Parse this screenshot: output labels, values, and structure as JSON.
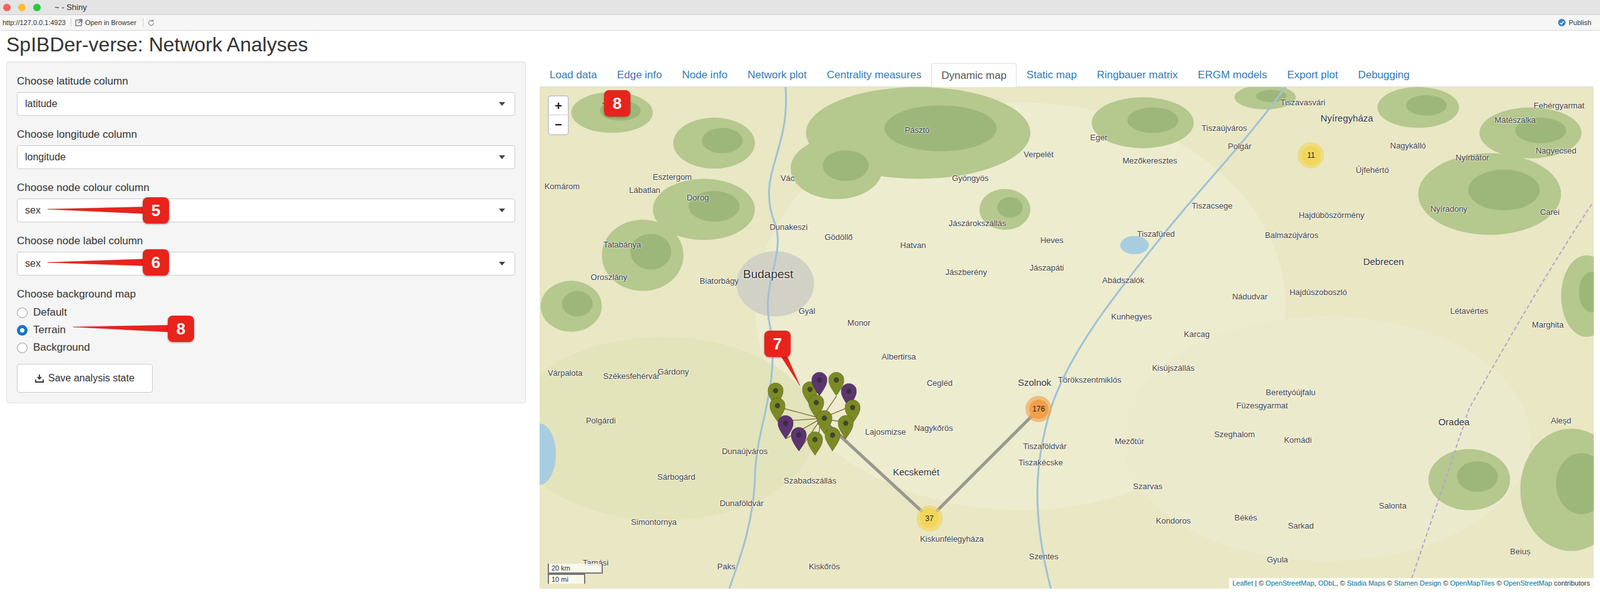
{
  "window": {
    "title": "~ - Shiny"
  },
  "toolbar": {
    "url": "http://127.0.0.1:4923",
    "open_in_browser": "Open in Browser",
    "publish": "Publish"
  },
  "app_title": "SpIBDer-verse: Network Analyses",
  "sidebar": {
    "fields": [
      {
        "label": "Choose latitude column",
        "value": "latitude"
      },
      {
        "label": "Choose longitude column",
        "value": "longitude"
      },
      {
        "label": "Choose node colour column",
        "value": "sex"
      },
      {
        "label": "Choose node label column",
        "value": "sex"
      }
    ],
    "background_map": {
      "label": "Choose background map",
      "options": [
        {
          "label": "Default",
          "selected": false
        },
        {
          "label": "Terrain",
          "selected": true
        },
        {
          "label": "Background",
          "selected": false
        }
      ]
    },
    "save_button": "Save analysis state"
  },
  "tabs": [
    {
      "label": "Load data",
      "selected": false
    },
    {
      "label": "Edge info",
      "selected": false
    },
    {
      "label": "Node info",
      "selected": false
    },
    {
      "label": "Network plot",
      "selected": false
    },
    {
      "label": "Centrality measures",
      "selected": false
    },
    {
      "label": "Dynamic map",
      "selected": true
    },
    {
      "label": "Static map",
      "selected": false
    },
    {
      "label": "Ringbauer matrix",
      "selected": false
    },
    {
      "label": "ERGM models",
      "selected": false
    },
    {
      "label": "Export plot",
      "selected": false
    },
    {
      "label": "Debugging",
      "selected": false
    }
  ],
  "map": {
    "zoom_in": "+",
    "zoom_out": "−",
    "scale": [
      "20 km",
      "10 mi"
    ],
    "attribution": [
      {
        "text": "Leaflet",
        "link": true
      },
      {
        "text": " | © ",
        "link": false
      },
      {
        "text": "OpenStreetMap",
        "link": true
      },
      {
        "text": ", ",
        "link": false
      },
      {
        "text": "ODbL",
        "link": true
      },
      {
        "text": ", © ",
        "link": false
      },
      {
        "text": "Stadia Maps",
        "link": true
      },
      {
        "text": " © ",
        "link": false
      },
      {
        "text": "Stamen Design",
        "link": true
      },
      {
        "text": " © ",
        "link": false
      },
      {
        "text": "OpenMapTiles",
        "link": true
      },
      {
        "text": " © ",
        "link": false
      },
      {
        "text": "OpenStreetMap",
        "link": true
      },
      {
        "text": " contributors",
        "link": false
      }
    ],
    "clusters": [
      {
        "count": "11",
        "color": "#f1d65a"
      },
      {
        "count": "176",
        "color": "#f2a04a"
      },
      {
        "count": "37",
        "color": "#f1d65a"
      }
    ],
    "pins": [
      {
        "color": "#7b8a24"
      },
      {
        "color": "#7b8a24"
      },
      {
        "color": "#7b8a24"
      },
      {
        "color": "#5c3470"
      },
      {
        "color": "#7b8a24"
      },
      {
        "color": "#5c3470"
      },
      {
        "color": "#7b8a24"
      },
      {
        "color": "#7b8a24"
      },
      {
        "color": "#7b8a24"
      },
      {
        "color": "#7b8a24"
      },
      {
        "color": "#7b8a24"
      },
      {
        "color": "#5c3470"
      },
      {
        "color": "#5c3470"
      },
      {
        "color": "#7b8a24"
      }
    ],
    "labels": [
      {
        "text": "Pásztó",
        "kind": "town"
      },
      {
        "text": "Eger",
        "kind": "town"
      },
      {
        "text": "Tiszavasvári",
        "kind": "town"
      },
      {
        "text": "Nyíregyháza",
        "kind": "city"
      },
      {
        "text": "Mátészalka",
        "kind": "town"
      },
      {
        "text": "Fehérgyarmat",
        "kind": "town"
      },
      {
        "text": "Tiszaújváros",
        "kind": "town"
      },
      {
        "text": "Polgár",
        "kind": "town"
      },
      {
        "text": "Nagykálló",
        "kind": "town"
      },
      {
        "text": "Nagyecsed",
        "kind": "town"
      },
      {
        "text": "Újfehértó",
        "kind": "town"
      },
      {
        "text": "Nyírbátor",
        "kind": "town"
      },
      {
        "text": "Verpelét",
        "kind": "town"
      },
      {
        "text": "Mezőkeresztes",
        "kind": "town"
      },
      {
        "text": "Gyöngyös",
        "kind": "town"
      },
      {
        "text": "Vác",
        "kind": "town"
      },
      {
        "text": "Esztergom",
        "kind": "town"
      },
      {
        "text": "Dorog",
        "kind": "town"
      },
      {
        "text": "Komárom",
        "kind": "town"
      },
      {
        "text": "Lábatlan",
        "kind": "town"
      },
      {
        "text": "Tiszacsege",
        "kind": "town"
      },
      {
        "text": "Hajdúböszörmény",
        "kind": "town"
      },
      {
        "text": "Nyíradony",
        "kind": "town"
      },
      {
        "text": "Carei",
        "kind": "town"
      },
      {
        "text": "Tatabánya",
        "kind": "town"
      },
      {
        "text": "Dunakeszi",
        "kind": "town"
      },
      {
        "text": "Gödöllő",
        "kind": "town"
      },
      {
        "text": "Hatvan",
        "kind": "town"
      },
      {
        "text": "Jászárokszállás",
        "kind": "town"
      },
      {
        "text": "Heves",
        "kind": "town"
      },
      {
        "text": "Tiszafüred",
        "kind": "town"
      },
      {
        "text": "Balmazújváros",
        "kind": "town"
      },
      {
        "text": "Debrecen",
        "kind": "city"
      },
      {
        "text": "Budapest",
        "kind": "capital"
      },
      {
        "text": "Jászberény",
        "kind": "town"
      },
      {
        "text": "Jászapáti",
        "kind": "town"
      },
      {
        "text": "Abádszalók",
        "kind": "town"
      },
      {
        "text": "Nádudvar",
        "kind": "town"
      },
      {
        "text": "Hajdúszoboszló",
        "kind": "town"
      },
      {
        "text": "Oroszlány",
        "kind": "town"
      },
      {
        "text": "Biatorbágy",
        "kind": "town"
      },
      {
        "text": "Gyál",
        "kind": "town"
      },
      {
        "text": "Monor",
        "kind": "town"
      },
      {
        "text": "Kunhegyes",
        "kind": "town"
      },
      {
        "text": "Karcag",
        "kind": "town"
      },
      {
        "text": "Létavértes",
        "kind": "town"
      },
      {
        "text": "Marghita",
        "kind": "town"
      },
      {
        "text": "Székesfehérvár",
        "kind": "town"
      },
      {
        "text": "Várpalota",
        "kind": "town"
      },
      {
        "text": "Gárdony",
        "kind": "town"
      },
      {
        "text": "Albertirsa",
        "kind": "town"
      },
      {
        "text": "Cegléd",
        "kind": "town"
      },
      {
        "text": "Szolnok",
        "kind": "city"
      },
      {
        "text": "Törökszentmiklós",
        "kind": "town"
      },
      {
        "text": "Kisújszállás",
        "kind": "town"
      },
      {
        "text": "Berettyóújfalu",
        "kind": "town"
      },
      {
        "text": "Oradea",
        "kind": "city"
      },
      {
        "text": "Polgárdi",
        "kind": "town"
      },
      {
        "text": "Lajosmizse",
        "kind": "town"
      },
      {
        "text": "Nagykőrös",
        "kind": "town"
      },
      {
        "text": "Füzesgyarmat",
        "kind": "town"
      },
      {
        "text": "Szeghalom",
        "kind": "town"
      },
      {
        "text": "Komádi",
        "kind": "town"
      },
      {
        "text": "Aleşd",
        "kind": "town"
      },
      {
        "text": "Mezőtúr",
        "kind": "town"
      },
      {
        "text": "Dunaújváros",
        "kind": "town"
      },
      {
        "text": "Kecskemét",
        "kind": "city"
      },
      {
        "text": "Tiszaföldvár",
        "kind": "town"
      },
      {
        "text": "Tiszakécske",
        "kind": "town"
      },
      {
        "text": "Szarvas",
        "kind": "town"
      },
      {
        "text": "Szabadszállás",
        "kind": "town"
      },
      {
        "text": "Sárbogárd",
        "kind": "town"
      },
      {
        "text": "Kiskunfélegyháza",
        "kind": "town"
      },
      {
        "text": "Kondoros",
        "kind": "town"
      },
      {
        "text": "Békés",
        "kind": "town"
      },
      {
        "text": "Sarkad",
        "kind": "town"
      },
      {
        "text": "Salonta",
        "kind": "town"
      },
      {
        "text": "Dunaföldvár",
        "kind": "town"
      },
      {
        "text": "Simontornya",
        "kind": "town"
      },
      {
        "text": "Szentes",
        "kind": "town"
      },
      {
        "text": "Gyula",
        "kind": "town"
      },
      {
        "text": "Beiuș",
        "kind": "town"
      },
      {
        "text": "Tamási",
        "kind": "town"
      },
      {
        "text": "Paks",
        "kind": "town"
      },
      {
        "text": "Kiskőrös",
        "kind": "town"
      }
    ]
  },
  "annotations": [
    {
      "number": "5"
    },
    {
      "number": "6"
    },
    {
      "number": "8"
    },
    {
      "number": "7"
    },
    {
      "number": "8"
    }
  ]
}
